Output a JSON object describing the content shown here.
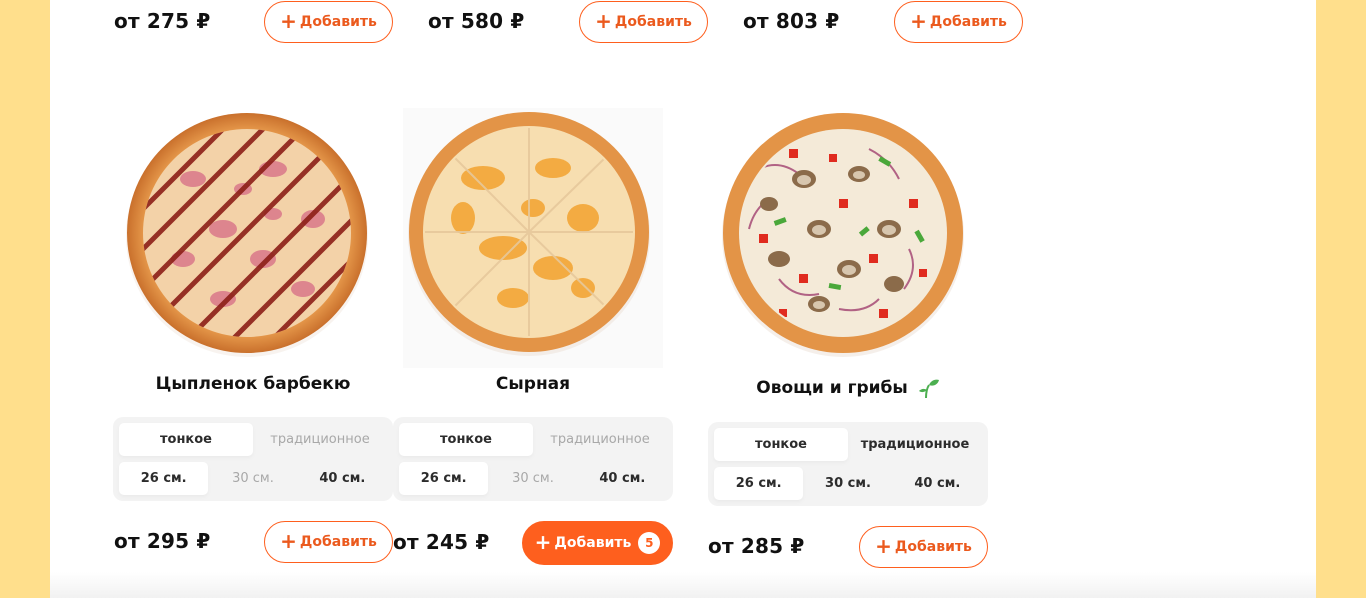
{
  "top_row": [
    {
      "price": "от 275 ₽",
      "add_label": "Добавить"
    },
    {
      "price": "от 580 ₽",
      "add_label": "Добавить"
    },
    {
      "price": "от 803 ₽",
      "add_label": "Добавить"
    }
  ],
  "pizzas": [
    {
      "title": "Цыпленок барбекю",
      "dough": [
        "тонкое",
        "традиционное"
      ],
      "sizes": [
        "26 см.",
        "30 см.",
        "40 см."
      ],
      "price": "от 295 ₽",
      "add_label": "Добавить"
    },
    {
      "title": "Сырная",
      "dough": [
        "тонкое",
        "традиционное"
      ],
      "sizes": [
        "26 см.",
        "30 см.",
        "40 см."
      ],
      "price": "от 245 ₽",
      "add_label": "Добавить",
      "count": "5"
    },
    {
      "title": "Овощи и грибы",
      "dough": [
        "тонкое",
        "традиционное"
      ],
      "sizes": [
        "26 см.",
        "30 см.",
        "40 см."
      ],
      "price": "от 285 ₽",
      "add_label": "Добавить",
      "icon": "sprout-icon"
    }
  ],
  "colors": {
    "accent": "#fe5f1e",
    "page_bg": "#ffdf8c",
    "selector_bg": "#f3f3f3"
  }
}
